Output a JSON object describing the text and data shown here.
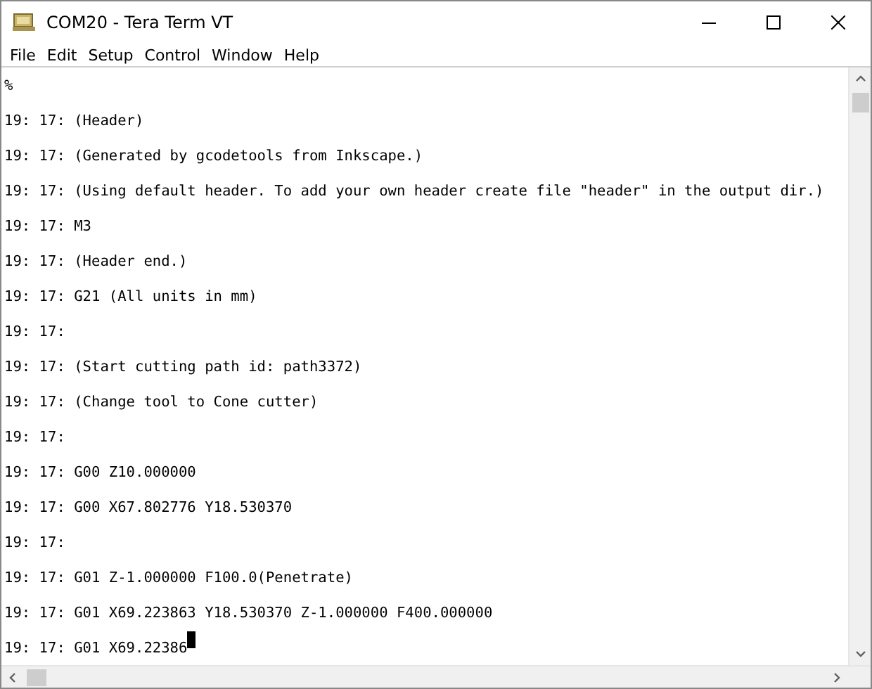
{
  "window": {
    "title": "COM20 - Tera Term VT"
  },
  "menu": [
    "File",
    "Edit",
    "Setup",
    "Control",
    "Window",
    "Help"
  ],
  "terminal": {
    "lines": [
      {
        "text": "%",
        "cursor": false
      },
      {
        "text": "19: 17: (Header)",
        "cursor": false
      },
      {
        "text": "19: 17: (Generated by gcodetools from Inkscape.)",
        "cursor": false
      },
      {
        "text": "19: 17: (Using default header. To add your own header create file \"header\" in the output dir.)",
        "cursor": false
      },
      {
        "text": "19: 17: M3",
        "cursor": false
      },
      {
        "text": "19: 17: (Header end.)",
        "cursor": false
      },
      {
        "text": "19: 17: G21 (All units in mm)",
        "cursor": false
      },
      {
        "text": "19: 17:",
        "cursor": false
      },
      {
        "text": "19: 17: (Start cutting path id: path3372)",
        "cursor": false
      },
      {
        "text": "19: 17: (Change tool to Cone cutter)",
        "cursor": false
      },
      {
        "text": "19: 17:",
        "cursor": false
      },
      {
        "text": "19: 17: G00 Z10.000000",
        "cursor": false
      },
      {
        "text": "19: 17: G00 X67.802776 Y18.530370",
        "cursor": false
      },
      {
        "text": "19: 17:",
        "cursor": false
      },
      {
        "text": "19: 17: G01 Z-1.000000 F100.0(Penetrate)",
        "cursor": false
      },
      {
        "text": "19: 17: G01 X69.223863 Y18.530370 Z-1.000000 F400.000000",
        "cursor": false
      },
      {
        "text": "19: 17: G01 X69.22386",
        "cursor": true
      }
    ]
  }
}
